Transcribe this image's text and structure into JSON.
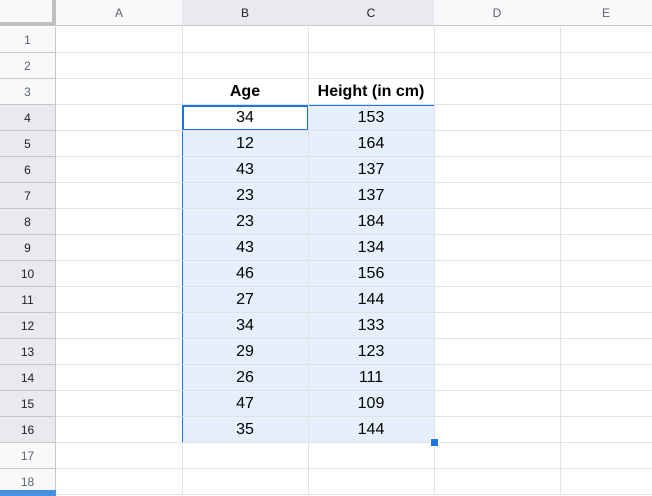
{
  "columns": [
    "A",
    "B",
    "C",
    "D",
    "E"
  ],
  "rows": [
    "1",
    "2",
    "3",
    "4",
    "5",
    "6",
    "7",
    "8",
    "9",
    "10",
    "11",
    "12",
    "13",
    "14",
    "15",
    "16",
    "17",
    "18"
  ],
  "headers": {
    "age": "Age",
    "height": "Height (in cm)"
  },
  "data": [
    {
      "age": "34",
      "height": "153"
    },
    {
      "age": "12",
      "height": "164"
    },
    {
      "age": "43",
      "height": "137"
    },
    {
      "age": "23",
      "height": "137"
    },
    {
      "age": "23",
      "height": "184"
    },
    {
      "age": "43",
      "height": "134"
    },
    {
      "age": "46",
      "height": "156"
    },
    {
      "age": "27",
      "height": "144"
    },
    {
      "age": "34",
      "height": "133"
    },
    {
      "age": "29",
      "height": "123"
    },
    {
      "age": "26",
      "height": "111"
    },
    {
      "age": "47",
      "height": "109"
    },
    {
      "age": "35",
      "height": "144"
    }
  ],
  "colors": {
    "selection": "#1a73e8",
    "header_bg": "#f8f9fa"
  }
}
